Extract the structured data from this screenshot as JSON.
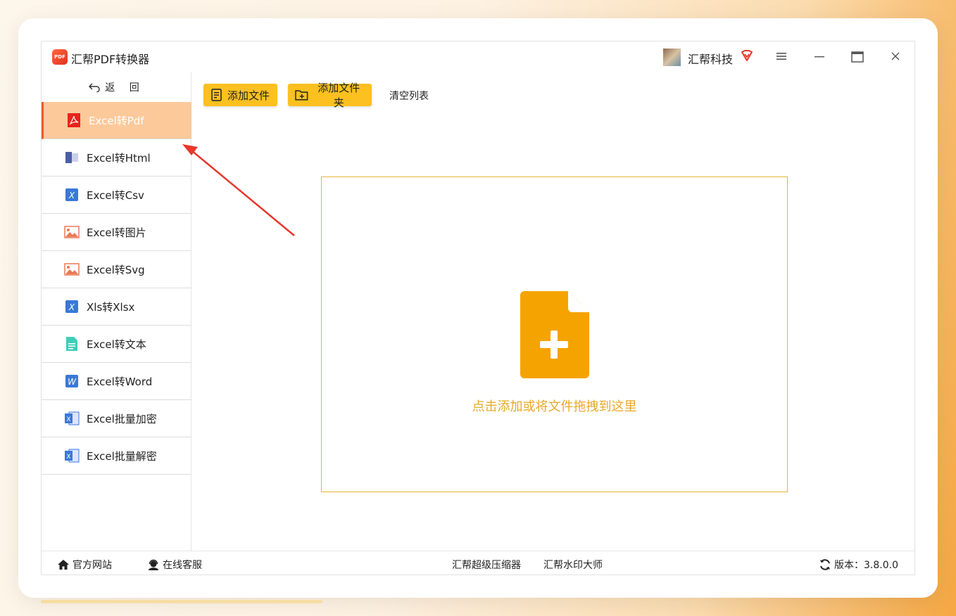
{
  "app": {
    "title": "汇帮PDF转换器",
    "logo_text": "PDF",
    "user_name": "汇帮科技"
  },
  "sidebar": {
    "back_label": "返 回",
    "items": [
      {
        "label": "Excel转Pdf",
        "icon": "pdf-icon",
        "active": true
      },
      {
        "label": "Excel转Html",
        "icon": "html-icon",
        "active": false
      },
      {
        "label": "Excel转Csv",
        "icon": "excel-icon",
        "active": false
      },
      {
        "label": "Excel转图片",
        "icon": "image-icon",
        "active": false
      },
      {
        "label": "Excel转Svg",
        "icon": "image-icon",
        "active": false
      },
      {
        "label": "Xls转Xlsx",
        "icon": "excel-icon",
        "active": false
      },
      {
        "label": "Excel转文本",
        "icon": "text-file-icon",
        "active": false
      },
      {
        "label": "Excel转Word",
        "icon": "word-icon",
        "active": false
      },
      {
        "label": "Excel批量加密",
        "icon": "excel-sheet-icon",
        "active": false
      },
      {
        "label": "Excel批量解密",
        "icon": "excel-sheet-icon",
        "active": false
      }
    ]
  },
  "toolbar": {
    "add_file": "添加文件",
    "add_folder": "添加文件夹",
    "clear_list": "清空列表"
  },
  "dropzone": {
    "text": "点击添加或将文件拖拽到这里"
  },
  "footer": {
    "website": "官方网站",
    "support": "在线客服",
    "compressor": "汇帮超级压缩器",
    "watermark": "汇帮水印大师",
    "version": "版本：3.8.0.0"
  },
  "colors": {
    "accent": "#fcc020",
    "active_item": "#fcc99b",
    "drop_border": "#e6b43a",
    "drop_text": "#e6a92a",
    "arrow": "#e8372b"
  }
}
